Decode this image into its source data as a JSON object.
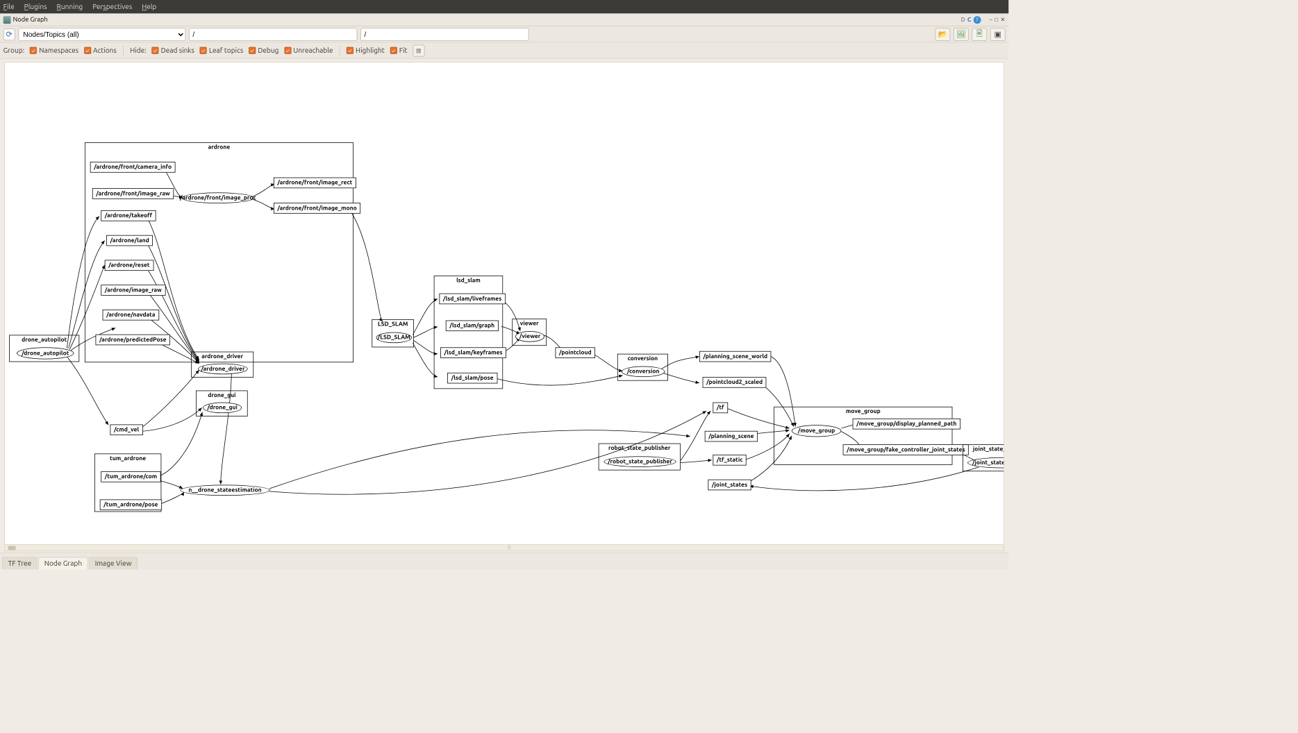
{
  "menu": {
    "file": "File",
    "plugins": "Plugins",
    "running": "Running",
    "perspectives": "Perspectives",
    "help": "Help"
  },
  "window": {
    "title": "Node Graph"
  },
  "toolbar": {
    "combo_value": "Nodes/Topics (all)",
    "filter1": "/",
    "filter2": "/"
  },
  "checks": {
    "group_label": "Group:",
    "namespaces": "Namespaces",
    "actions": "Actions",
    "hide_label": "Hide:",
    "dead_sinks": "Dead sinks",
    "leaf_topics": "Leaf topics",
    "debug": "Debug",
    "unreachable": "Unreachable",
    "highlight": "Highlight",
    "fit": "Fit"
  },
  "tabs": {
    "a": "TF Tree",
    "b": "Node Graph",
    "c": "Image View"
  },
  "titlebar_letters": {
    "d": "D",
    "c": "C"
  },
  "graph": {
    "groups": {
      "drone_autopilot": {
        "label": "drone_autopilot",
        "node": "/drone_autopilot"
      },
      "ardrone": {
        "label": "ardrone"
      },
      "tum_ardrone": {
        "label": "tum_ardrone"
      },
      "ardrone_driver": {
        "label": "ardrone_driver",
        "node": "/ardrone_driver"
      },
      "drone_gui": {
        "label": "drone_gui",
        "node": "/drone_gui"
      },
      "lsd_slam_outer": {
        "label": "LSD_SLAM",
        "node": "/LSD_SLAM"
      },
      "lsd_slam": {
        "label": "lsd_slam"
      },
      "viewer": {
        "label": "viewer",
        "node": "/viewer"
      },
      "conversion": {
        "label": "conversion",
        "node": "/conversion"
      },
      "robot_state_publisher": {
        "label": "robot_state_publisher",
        "node": "/robot_state_publisher"
      },
      "move_group": {
        "label": "move_group",
        "node": "/move_group"
      },
      "joint_state_publisher": {
        "label": "joint_state_publisher",
        "node": "/joint_state_publisher"
      }
    },
    "topics": {
      "ar_camera_info": "/ardrone/front/camera_info",
      "ar_image_raw": "/ardrone/front/image_raw",
      "ar_image_proc": "/ardrone/front/image_proc",
      "ar_image_rect": "/ardrone/front/image_rect",
      "ar_image_mono": "/ardrone/front/image_mono",
      "takeoff": "/ardrone/takeoff",
      "land": "/ardrone/land",
      "reset": "/ardrone/reset",
      "image_raw2": "/ardrone/image_raw",
      "navdata": "/ardrone/navdata",
      "predictedPose": "/ardrone/predictedPose",
      "cmd_vel": "/cmd_vel",
      "tum_com": "/tum_ardrone/com",
      "tum_pose": "/tum_ardrone/pose",
      "state_est": "n__drone_stateestimation",
      "lsd_live": "/lsd_slam/liveframes",
      "lsd_graph": "/lsd_slam/graph",
      "lsd_key": "/lsd_slam/keyframes",
      "lsd_pose": "/lsd_slam/pose",
      "pointcloud": "/pointcloud",
      "planning_world": "/planning_scene_world",
      "pointcloud2": "/pointcloud2_scaled",
      "tf": "/tf",
      "planning_scene": "/planning_scene",
      "tf_static": "/tf_static",
      "joint_states": "/joint_states",
      "display_path": "/move_group/display_planned_path",
      "fake_ctrl": "/move_group/fake_controller_joint_states"
    }
  }
}
